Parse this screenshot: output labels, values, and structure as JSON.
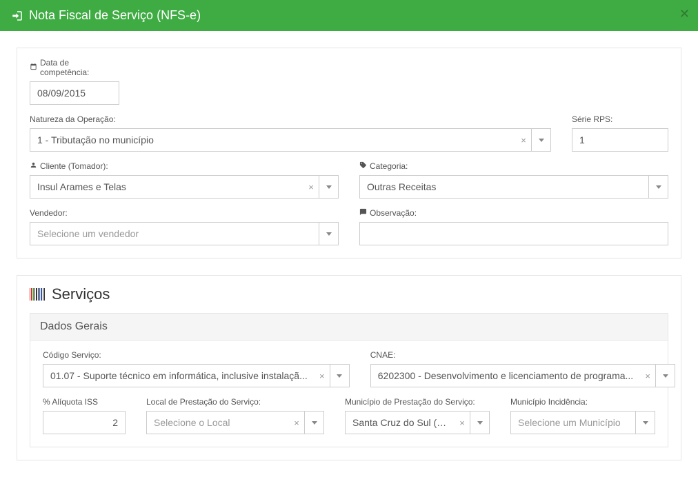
{
  "header": {
    "title": "Nota Fiscal de Serviço (NFS-e)"
  },
  "form": {
    "data_competencia": {
      "label": "Data de competência:",
      "value": "08/09/2015"
    },
    "natureza": {
      "label": "Natureza da Operação:",
      "value": "1 - Tributação no município"
    },
    "serie_rps": {
      "label": "Série RPS:",
      "value": "1"
    },
    "cliente": {
      "label": "Cliente (Tomador):",
      "value": "Insul Arames e Telas"
    },
    "categoria": {
      "label": "Categoria:",
      "value": "Outras Receitas"
    },
    "vendedor": {
      "label": "Vendedor:",
      "placeholder": "Selecione um vendedor"
    },
    "observacao": {
      "label": "Observação:",
      "value": ""
    }
  },
  "servicos": {
    "title": "Serviços",
    "dados_gerais": {
      "title": "Dados Gerais",
      "codigo_servico": {
        "label": "Código Serviço:",
        "value": "01.07 - Suporte técnico em informática, inclusive instalaçã..."
      },
      "cnae": {
        "label": "CNAE:",
        "value": "6202300 - Desenvolvimento e licenciamento de programa..."
      },
      "aliquota_iss": {
        "label": "% Alíquota ISS",
        "value": "2"
      },
      "local_prestacao": {
        "label": "Local de Prestação do Serviço:",
        "placeholder": "Selecione o Local"
      },
      "municipio_prestacao": {
        "label": "Município de Prestação do Serviço:",
        "value": "Santa Cruz do Sul (RS)"
      },
      "municipio_incidencia": {
        "label": "Município Incidência:",
        "placeholder": "Selecione um Município"
      }
    }
  }
}
